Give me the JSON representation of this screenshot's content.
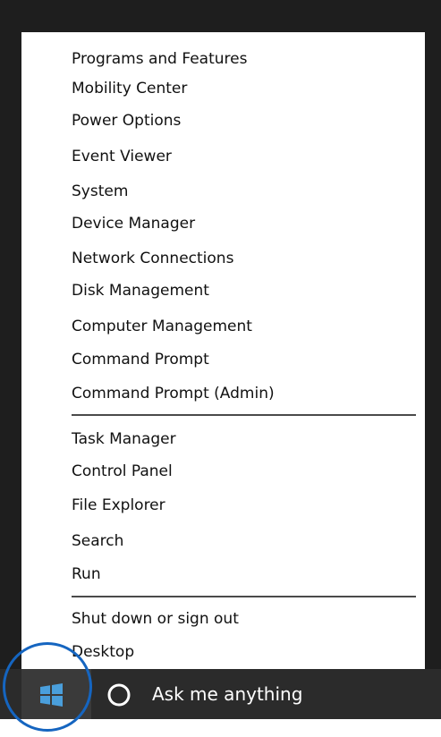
{
  "menu": {
    "groups": [
      {
        "items": [
          "Programs and Features",
          "Mobility Center",
          "Power Options",
          "Event Viewer",
          "System",
          "Device Manager",
          "Network Connections",
          "Disk Management",
          "Computer Management",
          "Command Prompt",
          "Command Prompt (Admin)"
        ]
      },
      {
        "items": [
          "Task Manager",
          "Control Panel",
          "File Explorer",
          "Search",
          "Run"
        ]
      },
      {
        "items": [
          "Shut down or sign out",
          "Desktop"
        ]
      }
    ]
  },
  "taskbar": {
    "search_label": "Ask me anything",
    "start_icon": "windows-logo-icon",
    "search_icon": "cortana-circle-icon",
    "colors": {
      "taskbar_bg": "#2b2b2b",
      "start_icon": "#4a9fdc",
      "highlight_circle": "#1565c0",
      "search_text": "#ffffff"
    }
  }
}
